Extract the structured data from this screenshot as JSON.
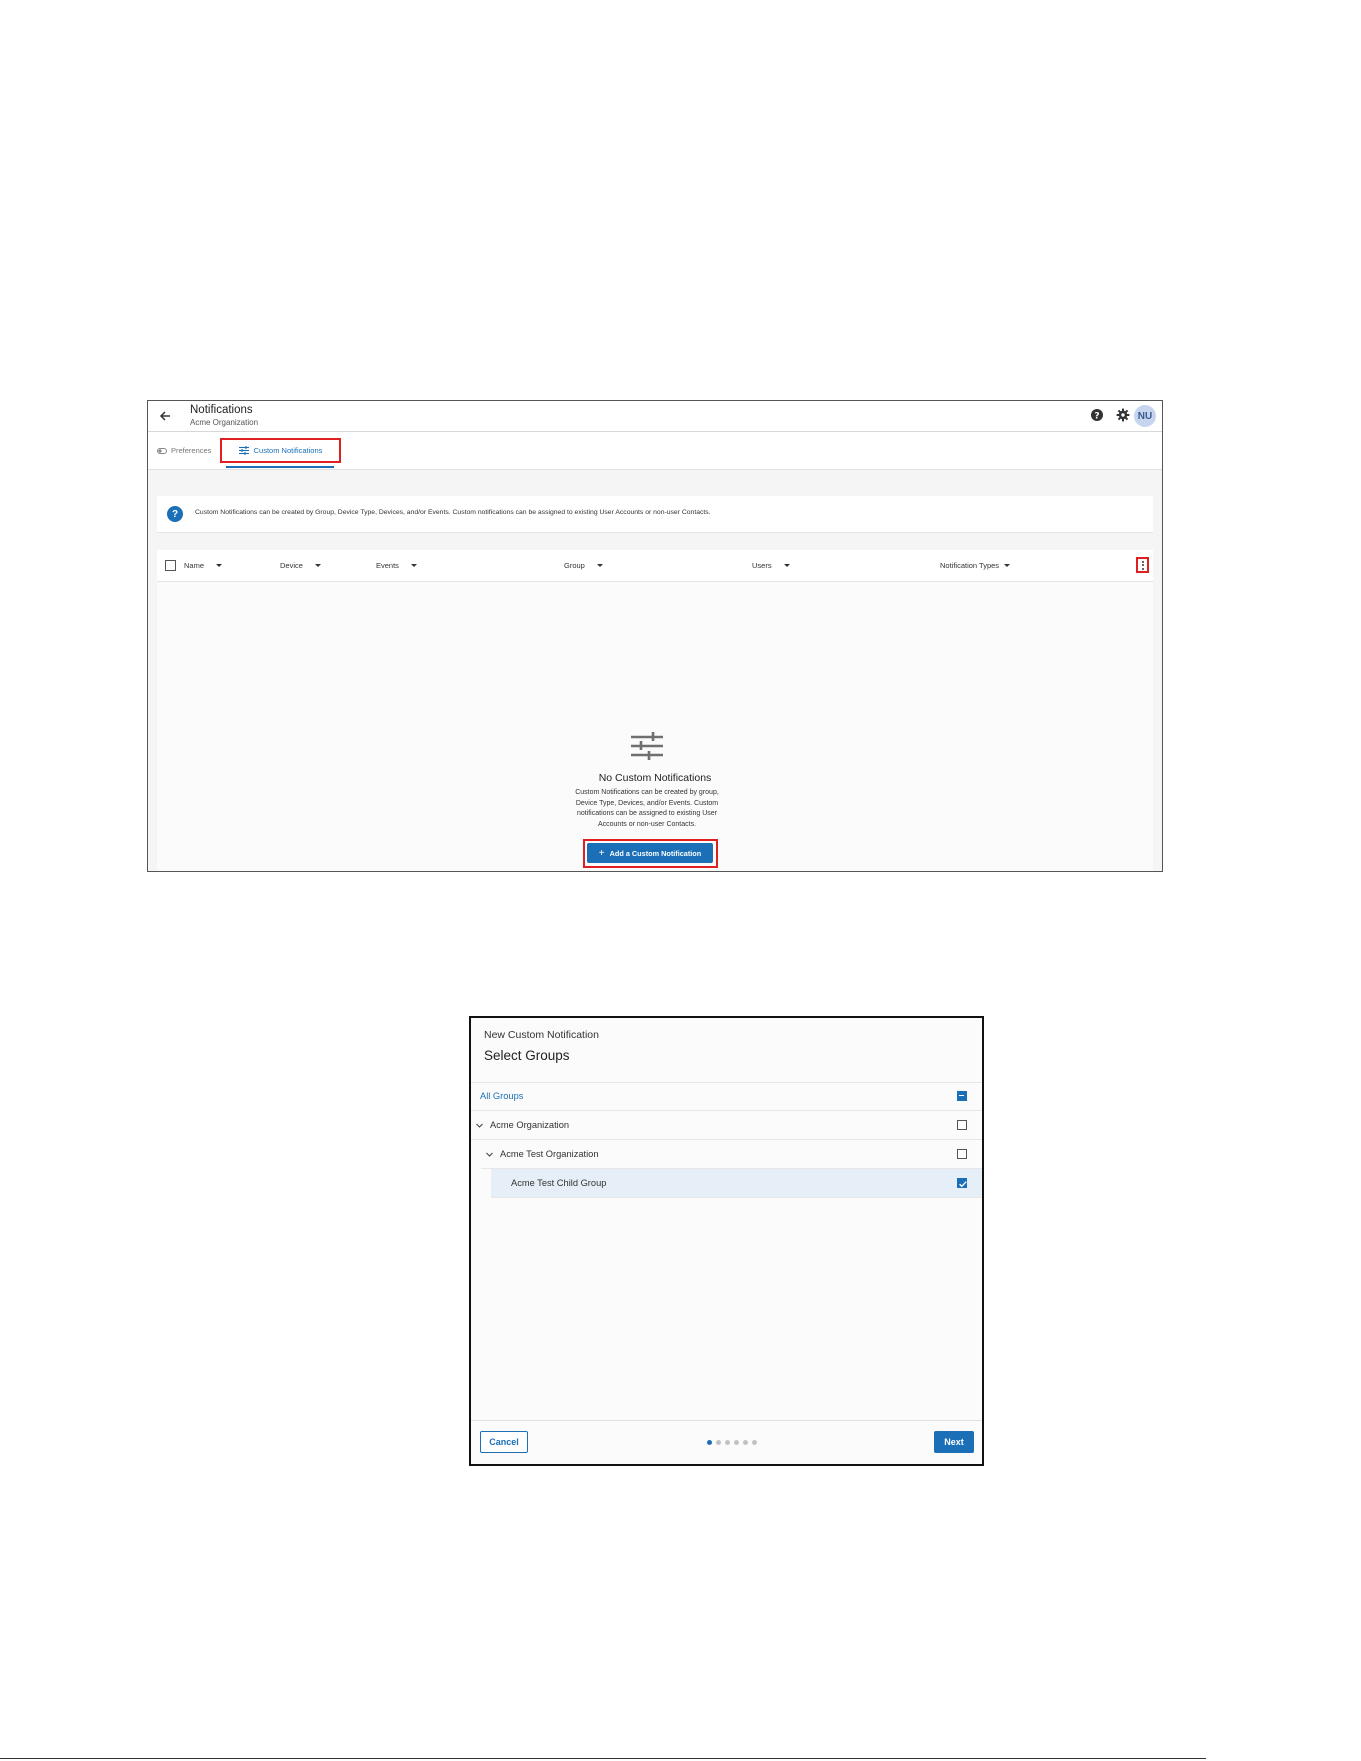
{
  "screen1": {
    "header": {
      "title": "Notifications",
      "subtitle": "Acme Organization",
      "avatar_initials": "NU",
      "icons": [
        "back-arrow-icon",
        "help-icon",
        "gear-icon"
      ]
    },
    "tabs": {
      "preferences": "Preferences",
      "custom_notifications": "Custom Notifications",
      "active": "Custom Notifications"
    },
    "info_banner": "Custom Notifications can be created by Group, Device Type, Devices, and/or Events. Custom notifications can be assigned to existing User Accounts or non-user Contacts.",
    "table": {
      "columns": [
        "Name",
        "Device",
        "Events",
        "Group",
        "Users",
        "Notification Types"
      ]
    },
    "empty_state": {
      "title": "No Custom Notifications",
      "description_lines": [
        "Custom Notifications can be created by group,",
        "Device Type, Devices, and/or Events. Custom",
        "notifications can be assigned to existing User",
        "Accounts or non-user Contacts."
      ],
      "button_label": "Add a Custom Notification"
    }
  },
  "screen2": {
    "overline": "New Custom Notification",
    "title": "Select Groups",
    "groups": [
      {
        "label": "All Groups",
        "state": "indeterminate",
        "level": 0,
        "expandable": false,
        "link": true
      },
      {
        "label": "Acme Organization",
        "state": "unchecked",
        "level": 0,
        "expandable": true
      },
      {
        "label": "Acme Test Organization",
        "state": "unchecked",
        "level": 1,
        "expandable": true
      },
      {
        "label": "Acme Test Child Group",
        "state": "checked",
        "level": 2,
        "expandable": false,
        "selected": true
      }
    ],
    "footer": {
      "cancel_label": "Cancel",
      "next_label": "Next",
      "step_current": 1,
      "step_total": 6
    }
  },
  "colors": {
    "accent": "#1a6fb6",
    "highlight_border": "#e02020",
    "selected_row": "#e6eff7"
  }
}
